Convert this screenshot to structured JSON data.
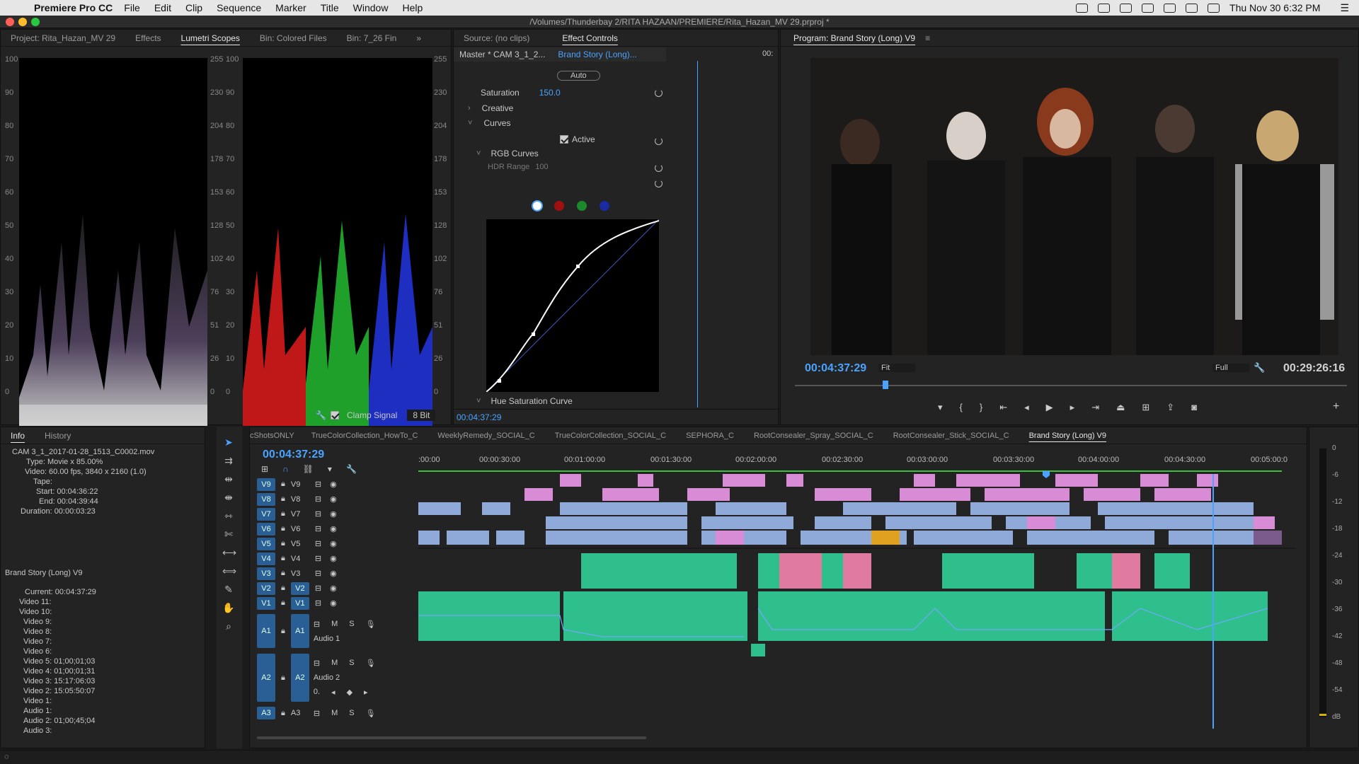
{
  "menubar": {
    "app": "Premiere Pro CC",
    "items": [
      "File",
      "Edit",
      "Clip",
      "Sequence",
      "Marker",
      "Title",
      "Window",
      "Help"
    ],
    "datetime": "Thu Nov 30  6:32 PM"
  },
  "window_title": "/Volumes/Thunderbay 2/RITA HAZAAN/PREMIERE/Rita_Hazan_MV 29.prproj *",
  "scopes": {
    "tabs": [
      "Project: Rita_Hazan_MV 29",
      "Effects",
      "Lumetri Scopes",
      "Bin: Colored Files",
      "Bin: 7_26 Fin"
    ],
    "left_axis": [
      "100",
      "90",
      "80",
      "70",
      "60",
      "50",
      "40",
      "30",
      "20",
      "10",
      "0"
    ],
    "right_axis": [
      "255",
      "230",
      "204",
      "178",
      "153",
      "128",
      "102",
      "76",
      "51",
      "26",
      "0"
    ],
    "clamp_label": "Clamp Signal",
    "bit_depth": "8 Bit"
  },
  "effect_controls": {
    "tab_source": "Source: (no clips)",
    "tab_ec": "Effect Controls",
    "master": "Master * CAM 3_1_2...",
    "sequence": "Brand Story (Long)...",
    "auto": "Auto",
    "saturation_label": "Saturation",
    "saturation_value": "150.0",
    "creative": "Creative",
    "curves": "Curves",
    "active": "Active",
    "rgb_curves": "RGB Curves",
    "hdr_range": "HDR Range",
    "hdr_value": "100",
    "hue_sat": "Hue Saturation Curve",
    "timecode": "00:04:37:29",
    "ruler_tc": "00:"
  },
  "program": {
    "title": "Program: Brand Story (Long) V9",
    "timecode": "00:04:37:29",
    "fit": "Fit",
    "quality": "Full",
    "duration": "00:29:26:16"
  },
  "info": {
    "tabs": [
      "Info",
      "History"
    ],
    "lines": [
      "CAM 3_1_2017-01-28_1513_C0002.mov",
      "Type: Movie x 85.00%",
      "Video: 60.00 fps, 3840 x 2160 (1.0)",
      "",
      "Tape:",
      "Start: 00:04:36:22",
      "End: 00:04:39:44",
      "Duration: 00:00:03:23"
    ],
    "seq_name": "Brand Story (Long) V9",
    "seq_lines": [
      "Current: 00:04:37:29",
      "Video 11:",
      "Video 10:",
      "Video 9:",
      "Video 8:",
      "Video 7:",
      "Video 6:",
      "Video 5: 01;00;01;03",
      "Video 4: 01;00;01;31",
      "Video 3: 15:17:06:03",
      "Video 2: 15:05:50:07",
      "Video 1:",
      "",
      "Audio 1:",
      "Audio 2: 01;00;45;04",
      "Audio 3:"
    ]
  },
  "timeline": {
    "tabs": [
      "cShotsONLY",
      "TrueColorCollection_HowTo_C",
      "WeeklyRemedy_SOCIAL_C",
      "TrueColorCollection_SOCIAL_C",
      "SEPHORA_C",
      "RootConsealer_Spray_SOCIAL_C",
      "RootConsealer_Stick_SOCIAL_C",
      "Brand Story (Long) V9"
    ],
    "timecode": "00:04:37:29",
    "ruler": [
      ":00:00",
      "00:00:30:00",
      "00:01:00:00",
      "00:01:30:00",
      "00:02:00:00",
      "00:02:30:00",
      "00:03:00:00",
      "00:03:30:00",
      "00:04:00:00",
      "00:04:30:00",
      "00:05:00:0"
    ],
    "video_tracks": [
      "V9",
      "V8",
      "V7",
      "V6",
      "V5",
      "V4",
      "V3",
      "V2",
      "V1"
    ],
    "audio_tracks": [
      {
        "id": "A1",
        "name": "Audio 1"
      },
      {
        "id": "A2",
        "name": "Audio 2"
      },
      {
        "id": "A3",
        "name": ""
      }
    ],
    "mute": "M",
    "solo": "S",
    "vol": "0."
  },
  "meter": {
    "labels": [
      "0",
      "-6",
      "-12",
      "-18",
      "-24",
      "-30",
      "-36",
      "-42",
      "-48",
      "-54",
      "dB"
    ]
  },
  "colors": {
    "accent": "#4aa3ff",
    "clip_blue": "#8fa9d8",
    "clip_pink": "#d98cd6",
    "audio_green": "#2fbf8c"
  }
}
